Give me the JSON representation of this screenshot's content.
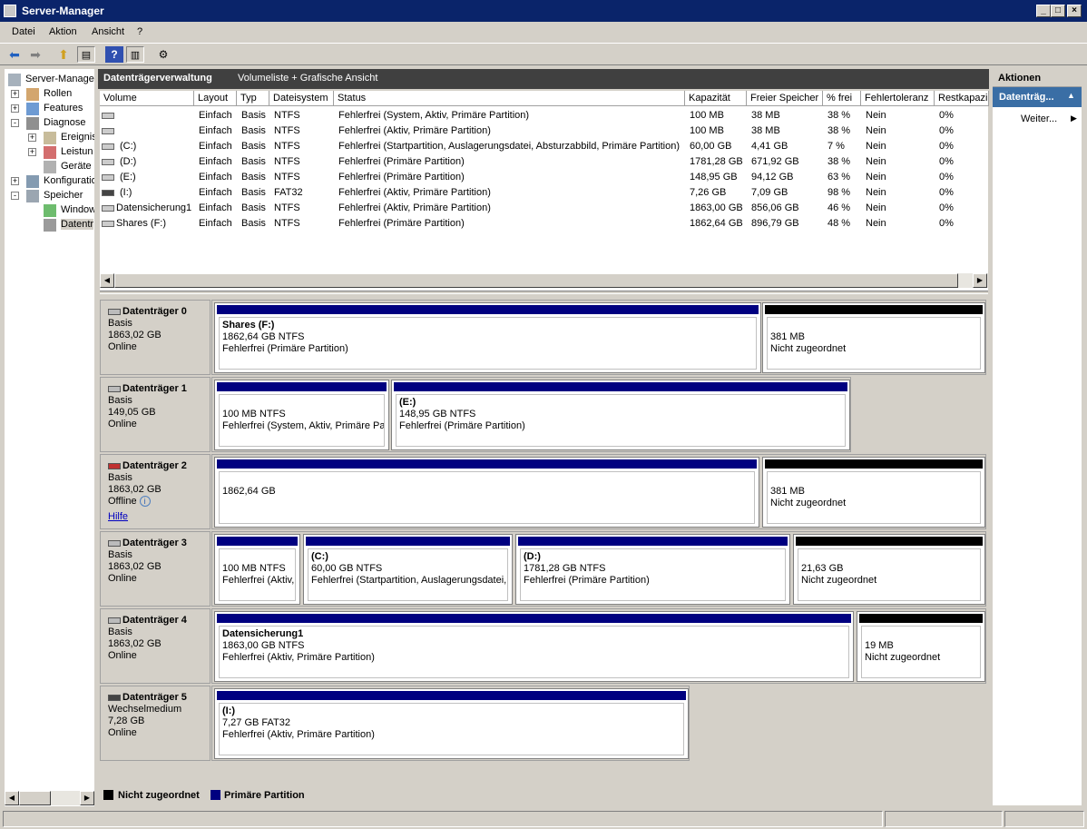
{
  "window": {
    "title": "Server-Manager"
  },
  "menu": [
    "Datei",
    "Aktion",
    "Ansicht",
    "?"
  ],
  "tree": {
    "items": [
      {
        "label": "Server-Manage",
        "icon": "server-icon"
      },
      {
        "label": "Rollen",
        "icon": "roles-icon"
      },
      {
        "label": "Features",
        "icon": "features-icon"
      },
      {
        "label": "Diagnose",
        "icon": "diagnose-icon"
      },
      {
        "label": "Ereignis",
        "icon": "event-icon"
      },
      {
        "label": "Leistun",
        "icon": "performance-icon"
      },
      {
        "label": "Geräte",
        "icon": "devices-icon"
      },
      {
        "label": "Konfiguratio",
        "icon": "config-icon"
      },
      {
        "label": "Speicher",
        "icon": "storage-icon"
      },
      {
        "label": "Window",
        "icon": "backup-icon"
      },
      {
        "label": "Datentr",
        "icon": "disk-management-icon"
      }
    ]
  },
  "header": {
    "title": "Datenträgerverwaltung",
    "subtitle": "Volumeliste + Grafische Ansicht"
  },
  "columns": [
    "Volume",
    "Layout",
    "Typ",
    "Dateisystem",
    "Status",
    "Kapazität",
    "Freier Speicher",
    "% frei",
    "Fehlertoleranz",
    "Restkapazi"
  ],
  "rows": [
    [
      "",
      "Einfach",
      "Basis",
      "NTFS",
      "Fehlerfrei (System, Aktiv, Primäre Partition)",
      "100 MB",
      "38 MB",
      "38 %",
      "Nein",
      "0%"
    ],
    [
      "",
      "Einfach",
      "Basis",
      "NTFS",
      "Fehlerfrei (Aktiv, Primäre Partition)",
      "100 MB",
      "38 MB",
      "38 %",
      "Nein",
      "0%"
    ],
    [
      "(C:)",
      "Einfach",
      "Basis",
      "NTFS",
      "Fehlerfrei (Startpartition, Auslagerungsdatei, Absturzabbild, Primäre Partition)",
      "60,00 GB",
      "4,41 GB",
      "7 %",
      "Nein",
      "0%"
    ],
    [
      "(D:)",
      "Einfach",
      "Basis",
      "NTFS",
      "Fehlerfrei (Primäre Partition)",
      "1781,28 GB",
      "671,92 GB",
      "38 %",
      "Nein",
      "0%"
    ],
    [
      "(E:)",
      "Einfach",
      "Basis",
      "NTFS",
      "Fehlerfrei (Primäre Partition)",
      "148,95 GB",
      "94,12 GB",
      "63 %",
      "Nein",
      "0%"
    ],
    [
      "(I:)",
      "Einfach",
      "Basis",
      "FAT32",
      "Fehlerfrei (Aktiv, Primäre Partition)",
      "7,26 GB",
      "7,09 GB",
      "98 %",
      "Nein",
      "0%"
    ],
    [
      "Datensicherung1",
      "Einfach",
      "Basis",
      "NTFS",
      "Fehlerfrei (Aktiv, Primäre Partition)",
      "1863,00 GB",
      "856,06 GB",
      "46 %",
      "Nein",
      "0%"
    ],
    [
      "Shares (F:)",
      "Einfach",
      "Basis",
      "NTFS",
      "Fehlerfrei (Primäre Partition)",
      "1862,64 GB",
      "896,79 GB",
      "48 %",
      "Nein",
      "0%"
    ]
  ],
  "disks": [
    {
      "name": "Datenträger 0",
      "type": "Basis",
      "size": "1863,02 GB",
      "state": "Online",
      "help": "",
      "parts": [
        {
          "kind": "primary",
          "title": "Shares  (F:)",
          "l1": "1862,64 GB NTFS",
          "l2": "Fehlerfrei (Primäre Partition)"
        },
        {
          "kind": "unalloc",
          "title": "",
          "l1": "381 MB",
          "l2": "Nicht zugeordnet"
        }
      ]
    },
    {
      "name": "Datenträger 1",
      "type": "Basis",
      "size": "149,05 GB",
      "state": "Online",
      "help": "",
      "parts": [
        {
          "kind": "primary",
          "title": "",
          "l1": "100 MB NTFS",
          "l2": "Fehlerfrei (System, Aktiv, Primäre Par"
        },
        {
          "kind": "primary",
          "title": "(E:)",
          "l1": "148,95 GB NTFS",
          "l2": "Fehlerfrei (Primäre Partition)"
        }
      ]
    },
    {
      "name": "Datenträger 2",
      "type": "Basis",
      "size": "1863,02 GB",
      "state": "Offline",
      "help": "Hilfe",
      "parts": [
        {
          "kind": "primary",
          "title": "",
          "l1": "1862,64 GB",
          "l2": ""
        },
        {
          "kind": "unalloc",
          "title": "",
          "l1": "381 MB",
          "l2": "Nicht zugeordnet"
        }
      ]
    },
    {
      "name": "Datenträger 3",
      "type": "Basis",
      "size": "1863,02 GB",
      "state": "Online",
      "help": "",
      "parts": [
        {
          "kind": "primary",
          "title": "",
          "l1": "100 MB NTFS",
          "l2": "Fehlerfrei (Aktiv,"
        },
        {
          "kind": "primary",
          "title": "(C:)",
          "l1": "60,00 GB NTFS",
          "l2": "Fehlerfrei (Startpartition, Auslagerungsdatei,"
        },
        {
          "kind": "primary",
          "title": "(D:)",
          "l1": "1781,28 GB NTFS",
          "l2": "Fehlerfrei (Primäre Partition)"
        },
        {
          "kind": "unalloc",
          "title": "",
          "l1": "21,63 GB",
          "l2": "Nicht zugeordnet"
        }
      ]
    },
    {
      "name": "Datenträger 4",
      "type": "Basis",
      "size": "1863,02 GB",
      "state": "Online",
      "help": "",
      "parts": [
        {
          "kind": "primary",
          "title": "Datensicherung1",
          "l1": "1863,00 GB NTFS",
          "l2": "Fehlerfrei (Aktiv, Primäre Partition)"
        },
        {
          "kind": "unalloc",
          "title": "",
          "l1": "19 MB",
          "l2": "Nicht zugeordnet"
        }
      ]
    },
    {
      "name": "Datenträger 5",
      "type": "Wechselmedium",
      "size": "7,28 GB",
      "state": "Online",
      "help": "",
      "parts": [
        {
          "kind": "primary",
          "title": "(I:)",
          "l1": "7,27 GB FAT32",
          "l2": "Fehlerfrei (Aktiv, Primäre Partition)"
        }
      ]
    }
  ],
  "legend": {
    "unalloc": "Nicht zugeordnet",
    "primary": "Primäre Partition"
  },
  "actions": {
    "title": "Aktionen",
    "section": "Datenträg...",
    "more": "Weiter..."
  },
  "colors": {
    "primary": "#000080",
    "unallocated": "#000000",
    "titlebar": "#0a246a"
  }
}
